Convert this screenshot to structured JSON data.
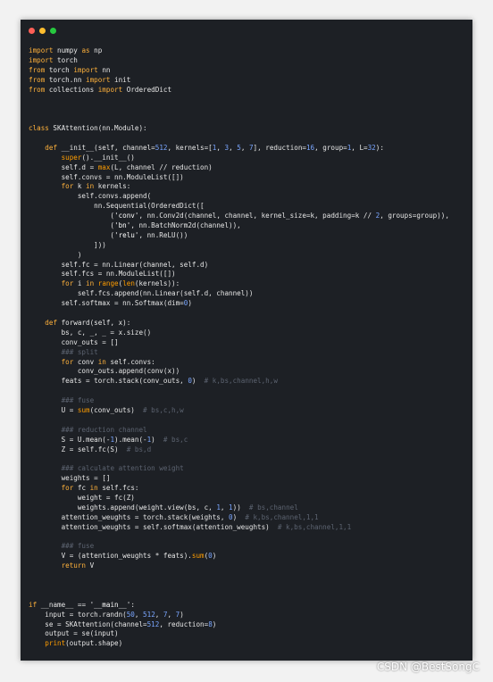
{
  "window": {
    "controls": [
      {
        "name": "close-dot",
        "color": "#ff5f56"
      },
      {
        "name": "minimize-dot",
        "color": "#ffbd2e"
      },
      {
        "name": "maximize-dot",
        "color": "#27c93f"
      }
    ]
  },
  "colors": {
    "keyword": "#ffb13b",
    "function": "#ff9d00",
    "number": "#7aa6ff",
    "string": "#ffffff",
    "comment": "#5c6370",
    "plain": "#e6e6e6"
  },
  "code_lines": [
    "import numpy as np",
    "import torch",
    "from torch import nn",
    "from torch.nn import init",
    "from collections import OrderedDict",
    "",
    "",
    "",
    "class SKAttention(nn.Module):",
    "",
    "    def __init__(self, channel=512, kernels=[1, 3, 5, 7], reduction=16, group=1, L=32):",
    "        super().__init__()",
    "        self.d = max(L, channel // reduction)",
    "        self.convs = nn.ModuleList([])",
    "        for k in kernels:",
    "            self.convs.append(",
    "                nn.Sequential(OrderedDict([",
    "                    ('conv', nn.Conv2d(channel, channel, kernel_size=k, padding=k // 2, groups=group)),",
    "                    ('bn', nn.BatchNorm2d(channel)),",
    "                    ('relu', nn.ReLU())",
    "                ]))",
    "            )",
    "        self.fc = nn.Linear(channel, self.d)",
    "        self.fcs = nn.ModuleList([])",
    "        for i in range(len(kernels)):",
    "            self.fcs.append(nn.Linear(self.d, channel))",
    "        self.softmax = nn.Softmax(dim=0)",
    "",
    "    def forward(self, x):",
    "        bs, c, _, _ = x.size()",
    "        conv_outs = []",
    "        ### split",
    "        for conv in self.convs:",
    "            conv_outs.append(conv(x))",
    "        feats = torch.stack(conv_outs, 0)  # k,bs,channel,h,w",
    "",
    "        ### fuse",
    "        U = sum(conv_outs)  # bs,c,h,w",
    "",
    "        ### reduction channel",
    "        S = U.mean(-1).mean(-1)  # bs,c",
    "        Z = self.fc(S)  # bs,d",
    "",
    "        ### calculate attention weight",
    "        weights = []",
    "        for fc in self.fcs:",
    "            weight = fc(Z)",
    "            weights.append(weight.view(bs, c, 1, 1))  # bs,channel",
    "        attention_weughts = torch.stack(weights, 0)  # k,bs,channel,1,1",
    "        attention_weughts = self.softmax(attention_weughts)  # k,bs,channel,1,1",
    "",
    "        ### fuse",
    "        V = (attention_weughts * feats).sum(0)",
    "        return V",
    "",
    "",
    "",
    "if __name__ == '__main__':",
    "    input = torch.randn(50, 512, 7, 7)",
    "    se = SKAttention(channel=512, reduction=8)",
    "    output = se(input)",
    "    print(output.shape)"
  ],
  "watermark": "CSDN @BestSongC"
}
